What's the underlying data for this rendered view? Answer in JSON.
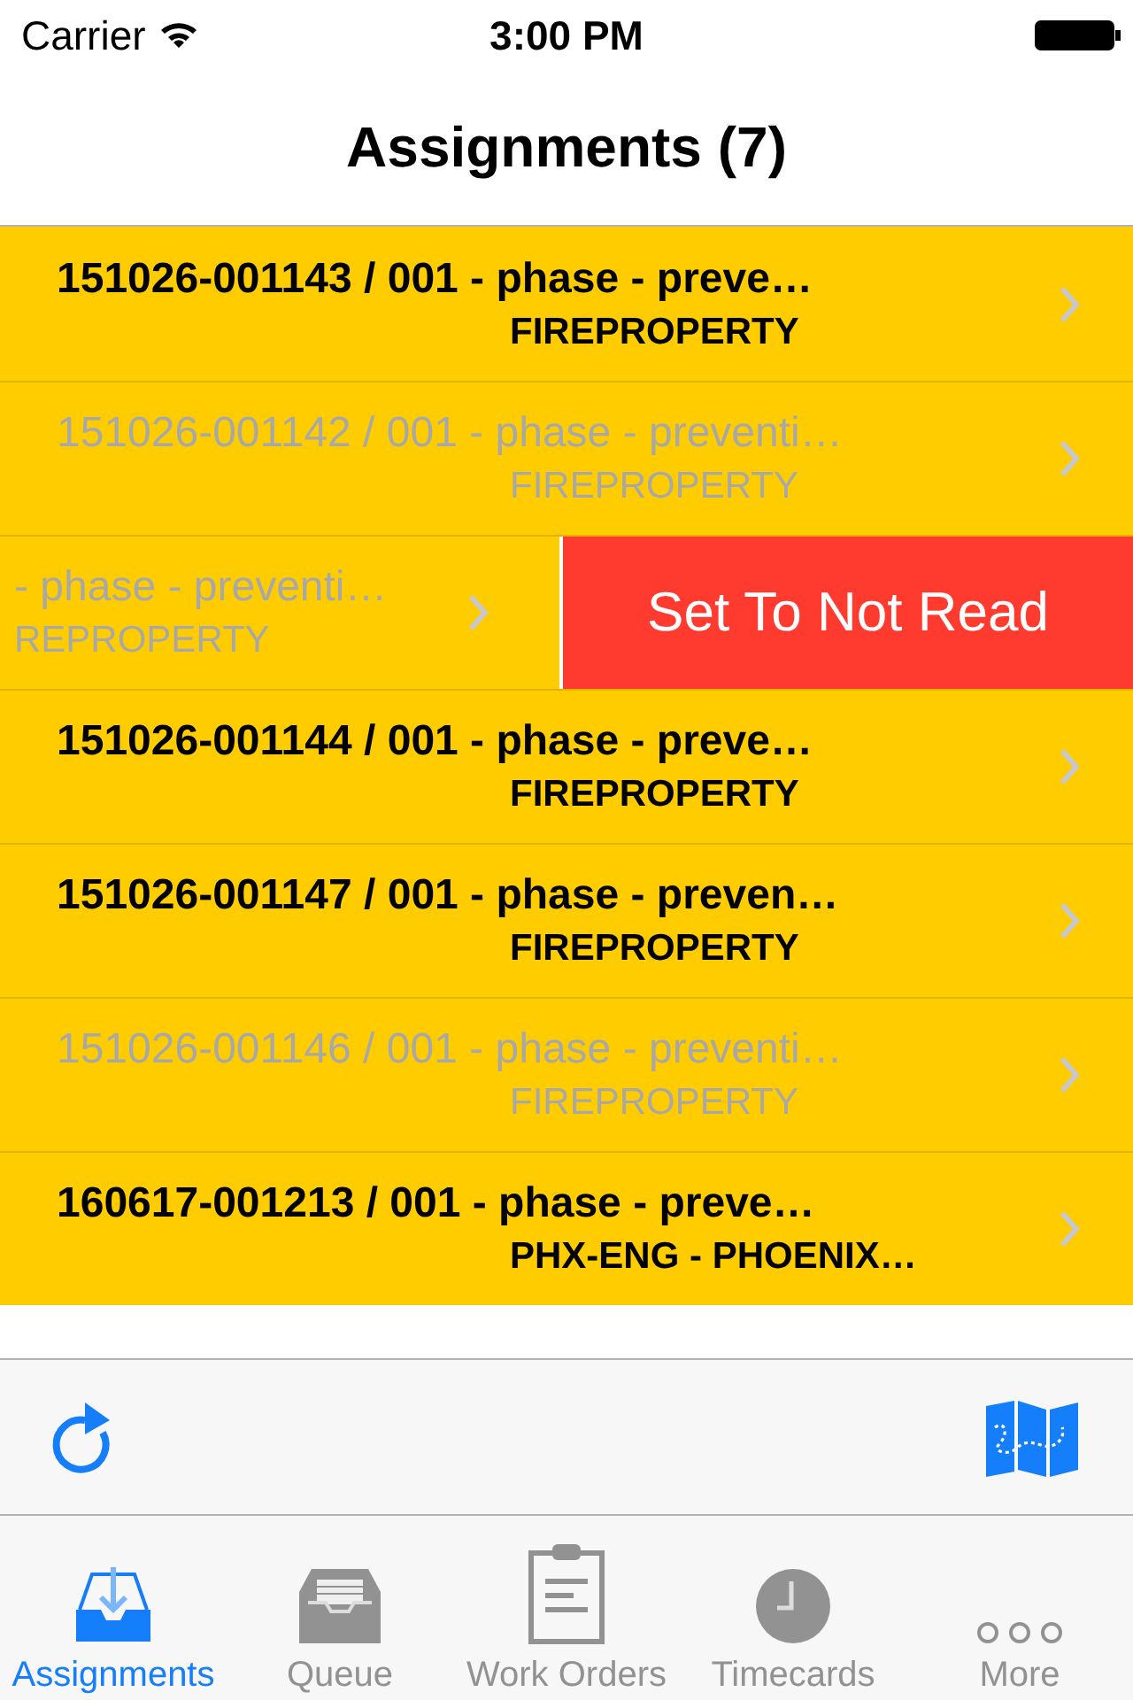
{
  "status_bar": {
    "carrier": "Carrier",
    "time": "3:00 PM"
  },
  "nav": {
    "title": "Assignments (7)"
  },
  "rows": [
    {
      "title": "151026-001143 / 001 - phase - preve…",
      "subtitle": "FIREPROPERTY",
      "read": false,
      "swiped": false
    },
    {
      "title": "151026-001142 / 001 - phase - preventi…",
      "subtitle": "FIREPROPERTY",
      "read": true,
      "swiped": false
    },
    {
      "title": "- phase - preventi…",
      "subtitle": "REPROPERTY",
      "read": true,
      "swiped": true,
      "action": "Set To Not Read"
    },
    {
      "title": "151026-001144 / 001 - phase - preve…",
      "subtitle": "FIREPROPERTY",
      "read": false,
      "swiped": false
    },
    {
      "title": "151026-001147 / 001 - phase - preven…",
      "subtitle": "FIREPROPERTY",
      "read": false,
      "swiped": false
    },
    {
      "title": "151026-001146 / 001 - phase - preventi…",
      "subtitle": "FIREPROPERTY",
      "read": true,
      "swiped": false
    },
    {
      "title": "160617-001213 / 001 - phase - preve…",
      "subtitle": "PHX-ENG - PHOENIX…",
      "read": false,
      "swiped": false
    }
  ],
  "tabs": [
    {
      "label": "Assignments",
      "kind": "inbox",
      "selected": true
    },
    {
      "label": "Queue",
      "kind": "tray",
      "selected": false
    },
    {
      "label": "Work Orders",
      "kind": "clipboard",
      "selected": false
    },
    {
      "label": "Timecards",
      "kind": "clock",
      "selected": false
    },
    {
      "label": "More",
      "kind": "more",
      "selected": false
    }
  ]
}
